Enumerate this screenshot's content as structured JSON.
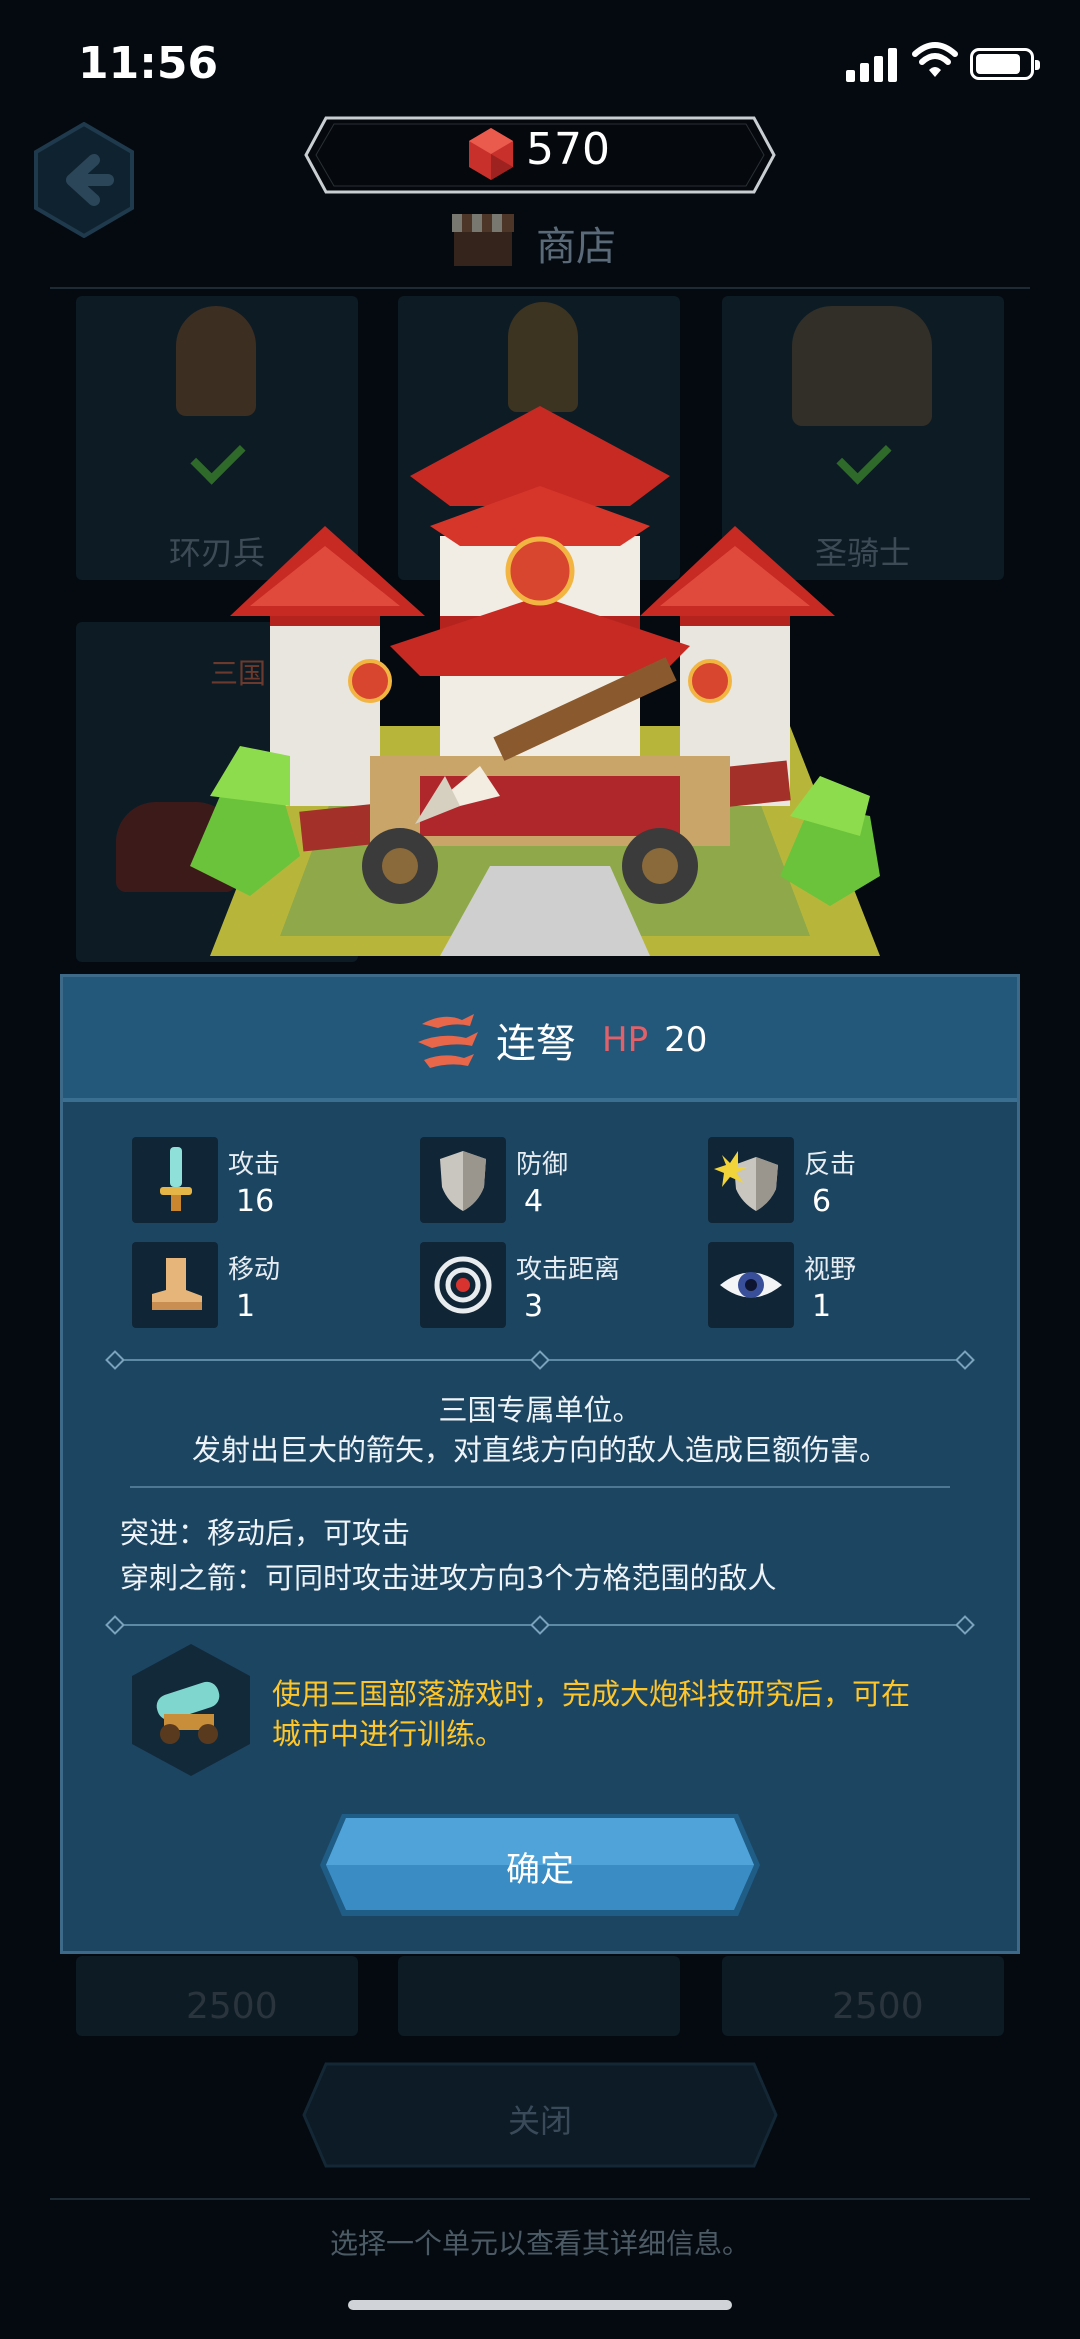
{
  "status_bar": {
    "time": "11:56"
  },
  "header": {
    "gems": "570",
    "shop_title": "商店"
  },
  "shop_cards": {
    "row1": [
      {
        "name": "环刃兵",
        "owned": true
      },
      {
        "name": "",
        "owned": false
      },
      {
        "name": "圣骑士",
        "owned": true
      }
    ],
    "row2_left_tag": "三国",
    "row3_prices": [
      "2500",
      "",
      "2500"
    ]
  },
  "modal": {
    "unit_name": "连弩",
    "hp_label": "HP",
    "hp_value": "20",
    "stats": [
      {
        "label": "攻击",
        "value": "16",
        "icon": "sword-icon"
      },
      {
        "label": "防御",
        "value": "4",
        "icon": "shield-icon"
      },
      {
        "label": "反击",
        "value": "6",
        "icon": "retaliation-icon"
      },
      {
        "label": "移动",
        "value": "1",
        "icon": "boot-icon"
      },
      {
        "label": "攻击距离",
        "value": "3",
        "icon": "target-icon"
      },
      {
        "label": "视野",
        "value": "1",
        "icon": "eye-icon"
      }
    ],
    "description_line1": "三国专属单位。",
    "description_line2": "发射出巨大的箭矢，对直线方向的敌人造成巨额伤害。",
    "ability1": "突进：移动后，可攻击",
    "ability2": "穿刺之箭：可同时攻击进攻方向3个方格范围的敌人",
    "requirement_line1": "使用三国部落游戏时，完成大炮科技研究后，可在",
    "requirement_line2": "城市中进行训练。",
    "confirm_label": "确定"
  },
  "footer": {
    "close_label": "关闭",
    "hint": "选择一个单元以查看其详细信息。"
  },
  "colors": {
    "modal_bg": "#1c4562",
    "requirement_text": "#ffc62a",
    "hp_label": "#e0616a",
    "button_blue": "#3a8dc4"
  }
}
